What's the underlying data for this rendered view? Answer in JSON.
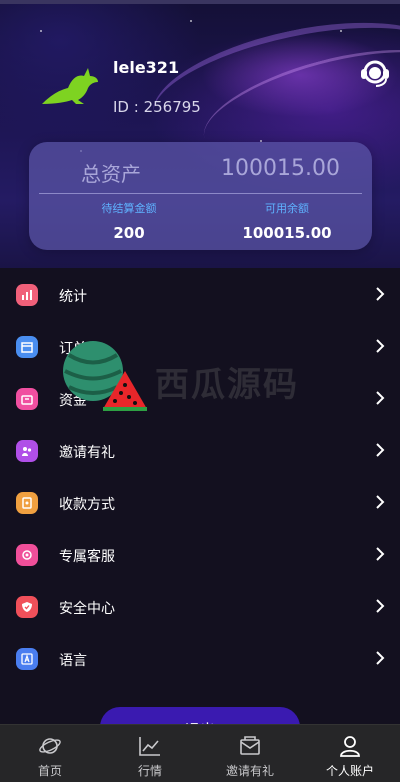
{
  "user": {
    "name": "lele321",
    "id_text": "ID : 256795",
    "avatar_icon": "kangaroo-icon"
  },
  "header": {
    "support_icon": "customer-service-icon"
  },
  "balance": {
    "total_label": "总资产",
    "total_value": "100015.00",
    "pending_label": "待结算金额",
    "pending_value": "200",
    "available_label": "可用余额",
    "available_value": "100015.00"
  },
  "menu": {
    "items": [
      {
        "label": "统计",
        "icon": "chart-icon",
        "color": "#f0607a"
      },
      {
        "label": "订单",
        "icon": "calendar-icon",
        "color": "#4a8ef0"
      },
      {
        "label": "资金",
        "icon": "wallet-icon",
        "color": "#f04fa0"
      },
      {
        "label": "邀请有礼",
        "icon": "invite-icon",
        "color": "#b04fe8"
      },
      {
        "label": "收款方式",
        "icon": "card-icon",
        "color": "#f0a040"
      },
      {
        "label": "专属客服",
        "icon": "headset-icon",
        "color": "#f04f9a"
      },
      {
        "label": "安全中心",
        "icon": "shield-icon",
        "color": "#f0505a"
      },
      {
        "label": "语言",
        "icon": "language-icon",
        "color": "#4a7ef0"
      }
    ]
  },
  "watermark": {
    "text": "西瓜源码"
  },
  "logout": {
    "label": "退出"
  },
  "tabbar": {
    "tabs": [
      {
        "label": "首页",
        "icon": "planet-icon"
      },
      {
        "label": "行情",
        "icon": "line-chart-icon"
      },
      {
        "label": "邀请有礼",
        "icon": "envelope-icon"
      },
      {
        "label": "个人账户",
        "icon": "person-icon"
      }
    ]
  },
  "colors": {
    "card_bg": "#5c56a8",
    "accent_blue": "#5fb2ff",
    "tabbar_bg": "#262628",
    "logout_btn": "#3a1ab0"
  }
}
